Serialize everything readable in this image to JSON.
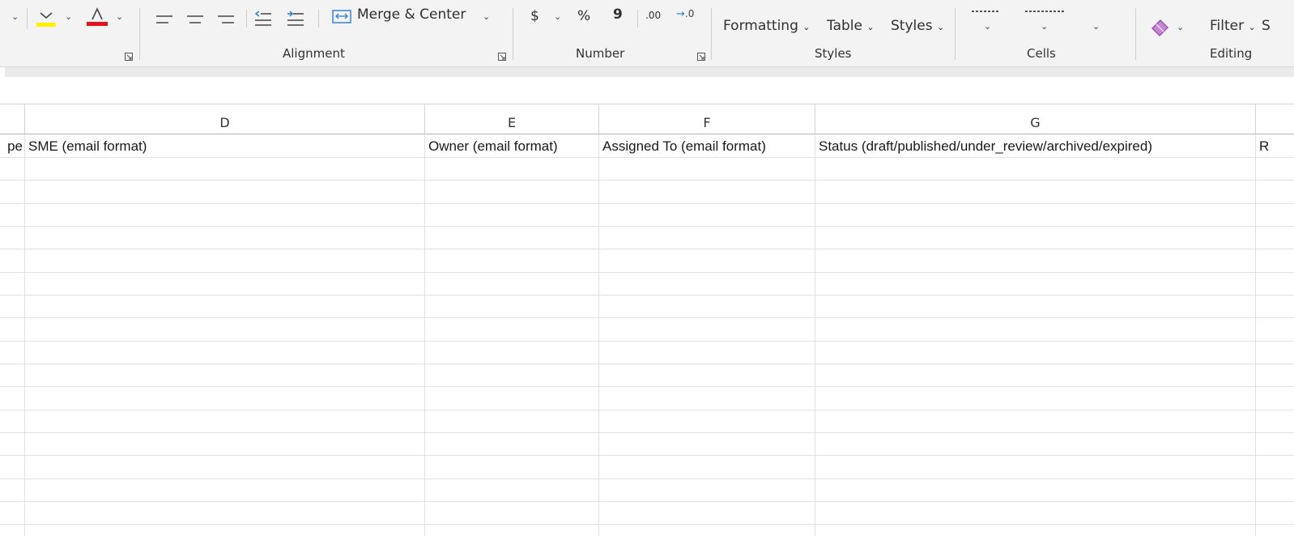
{
  "ribbon": {
    "alignment": {
      "merge_center_label": "Merge & Center"
    },
    "number": {
      "dollar_glyph": "$",
      "percent_glyph": "%",
      "comma_glyph": "9",
      "inc_decimal_glyph": ".00",
      "dec_decimal_glyph": ".0"
    },
    "styles": {
      "formatting_label": "Formatting",
      "table_label": "Table",
      "styles_label": "Styles"
    },
    "editing": {
      "filter_label": "Filter",
      "sort_label": "S"
    },
    "group_labels": {
      "alignment": "Alignment",
      "number": "Number",
      "styles": "Styles",
      "cells": "Cells",
      "editing": "Editing"
    },
    "icons": [
      "fill-color-icon",
      "font-color-icon",
      "align-left-icon",
      "align-center-icon",
      "align-right-icon",
      "decrease-indent-icon",
      "increase-indent-icon",
      "merge-center-icon",
      "dollar-icon",
      "percent-icon",
      "comma-style-icon",
      "increase-decimal-icon",
      "decrease-decimal-icon",
      "insert-icon",
      "delete-icon",
      "format-icon",
      "clear-eraser-icon"
    ],
    "colors": {
      "fill_yellow": "#ffef00",
      "font_red": "#e81123",
      "eraser_purple": "#9b4fb5"
    }
  },
  "columns": [
    {
      "letter": "",
      "key": "c"
    },
    {
      "letter": "D",
      "key": "d"
    },
    {
      "letter": "E",
      "key": "e"
    },
    {
      "letter": "F",
      "key": "f"
    },
    {
      "letter": "G",
      "key": "g"
    },
    {
      "letter": "",
      "key": "h"
    }
  ],
  "row1": {
    "c": "pe",
    "d": "SME (email format)",
    "e": "Owner (email format)",
    "f": "Assigned To (email format)",
    "g": "Status (draft/published/under_review/archived/expired)",
    "h": "R"
  }
}
